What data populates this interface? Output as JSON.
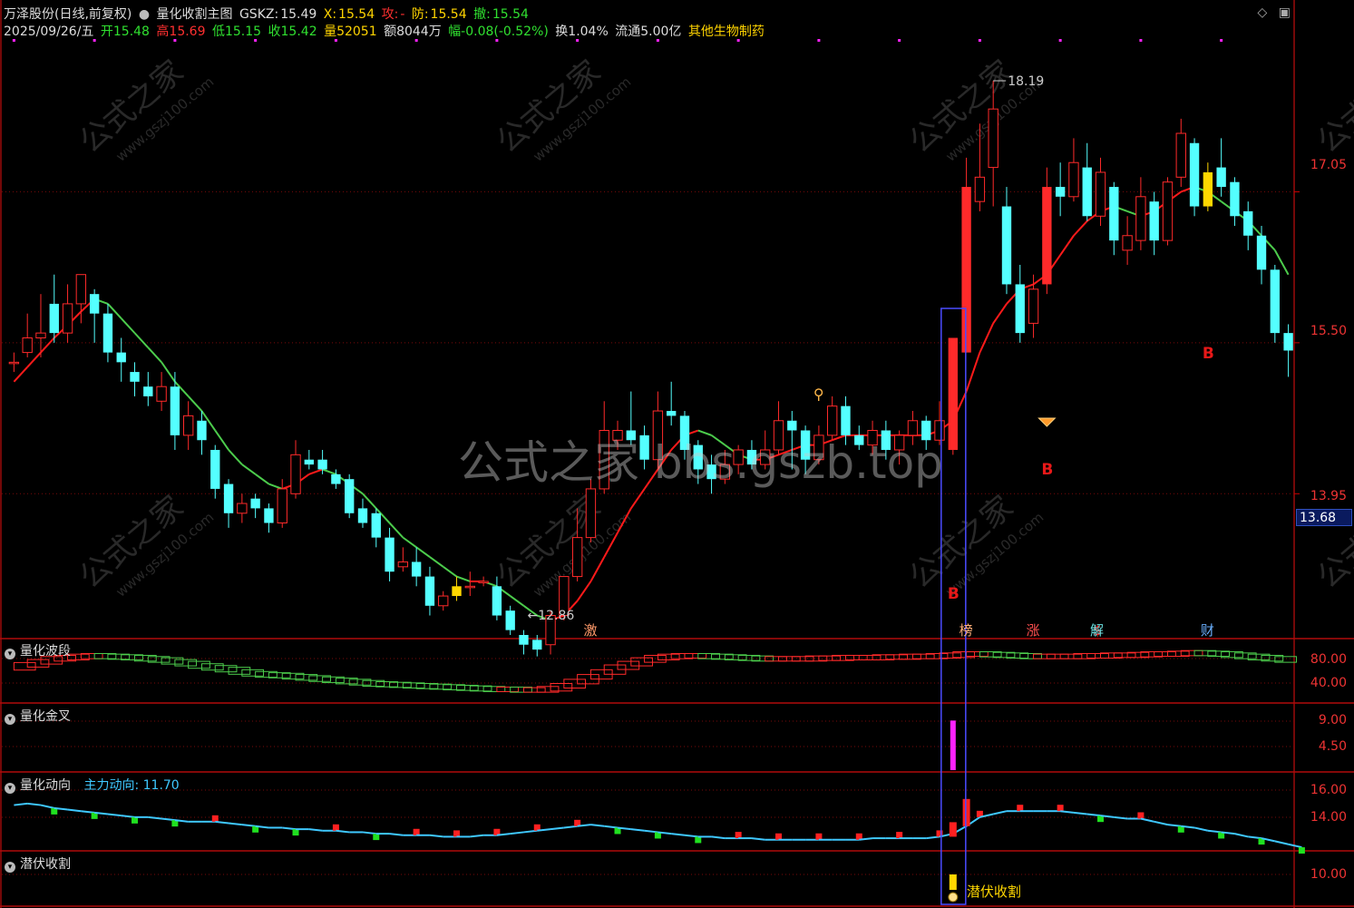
{
  "header": {
    "stock_name": "万泽股份(日线,前复权)",
    "indicator_name": "量化收割主图",
    "gskz_label": "GSKZ:",
    "gskz_value": "15.49",
    "x_label": "X:",
    "x_value": "15.54",
    "attack_label": "攻:",
    "attack_value": "-",
    "defense_label": "防:",
    "defense_value": "15.54",
    "withdraw_label": "撤:",
    "withdraw_value": "15.54"
  },
  "quote": {
    "date": "2025/09/26/五",
    "open_label": "开",
    "open": "15.48",
    "high_label": "高",
    "high": "15.69",
    "low_label": "低",
    "low": "15.15",
    "close_label": "收",
    "close": "15.42",
    "volume_label": "量",
    "volume": "52051",
    "amount_label": "额",
    "amount": "8044万",
    "change_label": "幅",
    "change": "-0.08(-0.52%)",
    "turnover_label": "换",
    "turnover": "1.04%",
    "float_label": "流通",
    "float_cap": "5.00亿",
    "sector": "其他生物制药"
  },
  "colors": {
    "up": "#ff2a2a",
    "down": "#54ffff",
    "ma_red": "#ff1a1a",
    "ma_green": "#4ccc4c",
    "grid": "#8b0000",
    "highlight_box": "#4a4cff",
    "yellow": "#ffd700",
    "magenta": "#ff22ff",
    "cyan": "#3fc8ff"
  },
  "current_price": "13.68",
  "watermark": "公式之家 bbs.gszb.top",
  "watermark_small": "公式之家",
  "watermark_url": "www.gszj100.com",
  "panes": {
    "main": {
      "axis_labels": [
        "17.05",
        "15.50",
        "13.95"
      ]
    },
    "wave": {
      "title": "量化波段",
      "axis_labels": [
        "80.00",
        "40.00"
      ]
    },
    "cross": {
      "title": "量化金叉",
      "axis_labels": [
        "9.00",
        "4.50"
      ]
    },
    "motion": {
      "title": "量化动向",
      "sub_label": "主力动向:",
      "sub_value": "11.70",
      "axis_labels": [
        "16.00",
        "14.00"
      ]
    },
    "harvest": {
      "title": "潜伏收割",
      "axis_labels": [
        "10.00"
      ],
      "signal_label": "潜伏收割"
    }
  },
  "annotations": {
    "high_price": "18.19",
    "low_price": "12.86",
    "buy_mark": "B",
    "bottom_marks": [
      "激",
      "榜",
      "涨",
      "$",
      "财",
      "解"
    ]
  },
  "chart_data": {
    "type": "candlestick",
    "title": "量化收割主图",
    "ylim": [
      12.5,
      18.6
    ],
    "axis_ticks": [
      17.05,
      15.5,
      13.95
    ],
    "bar_count": 96,
    "candles": [
      [
        15.3,
        15.3,
        15.4,
        15.2
      ],
      [
        15.4,
        15.55,
        15.8,
        15.35
      ],
      [
        15.55,
        15.6,
        16.0,
        15.35
      ],
      [
        15.9,
        15.6,
        16.2,
        15.5
      ],
      [
        15.6,
        15.9,
        16.1,
        15.5
      ],
      [
        15.9,
        16.2,
        16.2,
        15.7
      ],
      [
        16.0,
        15.8,
        16.05,
        15.5
      ],
      [
        15.8,
        15.4,
        15.9,
        15.3
      ],
      [
        15.4,
        15.3,
        15.55,
        15.1
      ],
      [
        15.2,
        15.1,
        15.3,
        14.95
      ],
      [
        15.05,
        14.95,
        15.2,
        14.85
      ],
      [
        14.9,
        15.05,
        15.2,
        14.8
      ],
      [
        15.05,
        14.55,
        15.2,
        14.4
      ],
      [
        14.55,
        14.75,
        14.9,
        14.4
      ],
      [
        14.7,
        14.5,
        14.8,
        14.35
      ],
      [
        14.4,
        14.0,
        14.45,
        13.9
      ],
      [
        14.05,
        13.75,
        14.1,
        13.6
      ],
      [
        13.75,
        13.85,
        13.95,
        13.65
      ],
      [
        13.9,
        13.8,
        13.95,
        13.7
      ],
      [
        13.8,
        13.65,
        13.85,
        13.55
      ],
      [
        13.65,
        14.0,
        14.1,
        13.6
      ],
      [
        13.95,
        14.35,
        14.5,
        13.9
      ],
      [
        14.3,
        14.25,
        14.4,
        14.2
      ],
      [
        14.3,
        14.2,
        14.4,
        14.15
      ],
      [
        14.15,
        14.05,
        14.2,
        14.0
      ],
      [
        14.1,
        13.75,
        14.15,
        13.7
      ],
      [
        13.8,
        13.65,
        13.9,
        13.6
      ],
      [
        13.75,
        13.5,
        13.8,
        13.4
      ],
      [
        13.5,
        13.15,
        13.6,
        13.05
      ],
      [
        13.2,
        13.25,
        13.4,
        13.15
      ],
      [
        13.25,
        13.1,
        13.4,
        13.0
      ],
      [
        13.1,
        12.8,
        13.2,
        12.7
      ],
      [
        12.8,
        12.9,
        12.95,
        12.75
      ],
      [
        12.9,
        13.0,
        13.1,
        12.85
      ],
      [
        13.0,
        13.0,
        13.15,
        12.9
      ],
      [
        13.05,
        13.05,
        13.1,
        13.0
      ],
      [
        13.0,
        12.7,
        13.1,
        12.65
      ],
      [
        12.75,
        12.55,
        12.8,
        12.5
      ],
      [
        12.5,
        12.4,
        12.55,
        12.3
      ],
      [
        12.45,
        12.35,
        12.5,
        12.28
      ],
      [
        12.4,
        12.7,
        12.75,
        12.3
      ],
      [
        12.7,
        13.1,
        13.1,
        12.65
      ],
      [
        13.1,
        13.5,
        13.8,
        13.05
      ],
      [
        13.5,
        14.0,
        14.1,
        13.45
      ],
      [
        14.0,
        14.6,
        14.9,
        13.95
      ],
      [
        14.5,
        14.6,
        14.7,
        14.4
      ],
      [
        14.6,
        14.5,
        15.0,
        14.45
      ],
      [
        14.55,
        14.3,
        14.65,
        14.2
      ],
      [
        14.3,
        14.8,
        15.0,
        14.2
      ],
      [
        14.8,
        14.75,
        15.1,
        14.65
      ],
      [
        14.75,
        14.4,
        14.8,
        14.3
      ],
      [
        14.45,
        14.2,
        14.5,
        14.05
      ],
      [
        14.25,
        14.1,
        14.35,
        13.95
      ],
      [
        14.1,
        14.25,
        14.4,
        14.05
      ],
      [
        14.25,
        14.4,
        14.45,
        14.15
      ],
      [
        14.4,
        14.25,
        14.5,
        14.2
      ],
      [
        14.25,
        14.4,
        14.6,
        14.2
      ],
      [
        14.4,
        14.7,
        14.9,
        14.35
      ],
      [
        14.7,
        14.6,
        14.8,
        14.2
      ],
      [
        14.6,
        14.3,
        14.65,
        14.15
      ],
      [
        14.3,
        14.55,
        14.65,
        14.25
      ],
      [
        14.55,
        14.85,
        14.95,
        14.5
      ],
      [
        14.85,
        14.55,
        14.95,
        14.45
      ],
      [
        14.55,
        14.45,
        14.65,
        14.4
      ],
      [
        14.45,
        14.6,
        14.7,
        14.35
      ],
      [
        14.6,
        14.4,
        14.7,
        14.3
      ],
      [
        14.4,
        14.55,
        14.6,
        14.25
      ],
      [
        14.55,
        14.7,
        14.8,
        14.45
      ],
      [
        14.7,
        14.5,
        14.75,
        14.4
      ],
      [
        14.5,
        14.7,
        14.9,
        14.45
      ],
      [
        14.4,
        15.55,
        15.55,
        14.35
      ],
      [
        15.4,
        17.1,
        17.4,
        15.4
      ],
      [
        16.95,
        17.2,
        17.75,
        16.85
      ],
      [
        17.3,
        17.9,
        18.19,
        16.9
      ],
      [
        16.9,
        16.1,
        17.1,
        16.0
      ],
      [
        16.1,
        15.6,
        16.3,
        15.5
      ],
      [
        15.7,
        16.05,
        16.2,
        15.55
      ],
      [
        16.1,
        17.1,
        17.3,
        16.0
      ],
      [
        17.1,
        17.0,
        17.35,
        16.8
      ],
      [
        17.0,
        17.35,
        17.6,
        16.95
      ],
      [
        17.3,
        16.8,
        17.55,
        16.75
      ],
      [
        16.8,
        17.25,
        17.4,
        16.7
      ],
      [
        17.1,
        16.55,
        17.15,
        16.4
      ],
      [
        16.45,
        16.6,
        16.8,
        16.3
      ],
      [
        16.55,
        17.0,
        17.2,
        16.45
      ],
      [
        16.95,
        16.55,
        17.05,
        16.4
      ],
      [
        16.55,
        17.15,
        17.2,
        16.5
      ],
      [
        17.2,
        17.65,
        17.8,
        17.1
      ],
      [
        17.55,
        16.9,
        17.6,
        16.8
      ],
      [
        16.9,
        17.25,
        17.35,
        16.85
      ],
      [
        17.3,
        17.1,
        17.6,
        17.0
      ],
      [
        17.15,
        16.8,
        17.2,
        16.7
      ],
      [
        16.85,
        16.6,
        16.95,
        16.45
      ],
      [
        16.6,
        16.25,
        16.7,
        16.1
      ],
      [
        16.25,
        15.6,
        16.3,
        15.5
      ],
      [
        15.6,
        15.42,
        15.69,
        15.15
      ]
    ],
    "ma": [
      15.1,
      15.25,
      15.4,
      15.55,
      15.68,
      15.82,
      15.95,
      15.9,
      15.75,
      15.6,
      15.45,
      15.3,
      15.1,
      14.95,
      14.8,
      14.6,
      14.4,
      14.25,
      14.15,
      14.05,
      14.0,
      14.05,
      14.15,
      14.2,
      14.15,
      14.05,
      13.95,
      13.8,
      13.65,
      13.5,
      13.4,
      13.3,
      13.2,
      13.1,
      13.05,
      13.05,
      13.0,
      12.9,
      12.8,
      12.7,
      12.65,
      12.7,
      12.85,
      13.05,
      13.3,
      13.55,
      13.8,
      14.0,
      14.2,
      14.4,
      14.55,
      14.6,
      14.55,
      14.45,
      14.35,
      14.3,
      14.3,
      14.35,
      14.4,
      14.45,
      14.45,
      14.5,
      14.55,
      14.55,
      14.55,
      14.55,
      14.55,
      14.55,
      14.55,
      14.6,
      14.7,
      15.0,
      15.4,
      15.7,
      15.9,
      16.05,
      16.1,
      16.2,
      16.4,
      16.6,
      16.75,
      16.85,
      16.9,
      16.85,
      16.8,
      16.85,
      16.95,
      17.05,
      17.1,
      17.05,
      16.95,
      16.85,
      16.75,
      16.6,
      16.45,
      16.2
    ],
    "wave": [
      55,
      60,
      65,
      70,
      72,
      74,
      75,
      74,
      73,
      72,
      70,
      68,
      65,
      62,
      58,
      55,
      52,
      48,
      45,
      43,
      42,
      40,
      38,
      36,
      34,
      32,
      30,
      28,
      27,
      26,
      25,
      24,
      23,
      22,
      21,
      20,
      19,
      19,
      18,
      18,
      20,
      25,
      32,
      40,
      48,
      56,
      62,
      68,
      72,
      74,
      75,
      75,
      74,
      73,
      72,
      71,
      70,
      70,
      70,
      70,
      71,
      71,
      72,
      72,
      72,
      73,
      73,
      74,
      74,
      75,
      76,
      78,
      78,
      77,
      76,
      75,
      74,
      74,
      74,
      74,
      75,
      75,
      76,
      76,
      77,
      78,
      78,
      79,
      80,
      79,
      78,
      76,
      74,
      72,
      70,
      68
    ],
    "cross": {
      "bar_index": 70,
      "value": 8.2
    },
    "motion": [
      15.4,
      15.5,
      15.4,
      15.2,
      15.1,
      15.0,
      14.9,
      14.8,
      14.7,
      14.6,
      14.6,
      14.5,
      14.4,
      14.3,
      14.3,
      14.3,
      14.2,
      14.1,
      14.0,
      13.9,
      13.9,
      13.8,
      13.8,
      13.7,
      13.7,
      13.6,
      13.6,
      13.5,
      13.5,
      13.4,
      13.4,
      13.4,
      13.3,
      13.3,
      13.3,
      13.4,
      13.4,
      13.5,
      13.6,
      13.7,
      13.8,
      13.9,
      14.0,
      14.1,
      14.0,
      13.9,
      13.8,
      13.7,
      13.6,
      13.5,
      13.4,
      13.3,
      13.3,
      13.2,
      13.2,
      13.2,
      13.1,
      13.1,
      13.1,
      13.1,
      13.1,
      13.1,
      13.1,
      13.1,
      13.2,
      13.2,
      13.2,
      13.2,
      13.2,
      13.3,
      13.5,
      14.0,
      14.6,
      14.8,
      15.0,
      15.0,
      15.0,
      15.0,
      15.0,
      14.9,
      14.8,
      14.7,
      14.6,
      14.5,
      14.5,
      14.3,
      14.1,
      14.0,
      13.9,
      13.7,
      13.6,
      13.5,
      13.3,
      13.2,
      13.0,
      12.8,
      12.6
    ],
    "harvest": {
      "bar_index": 70,
      "label": "潜伏收割"
    }
  }
}
